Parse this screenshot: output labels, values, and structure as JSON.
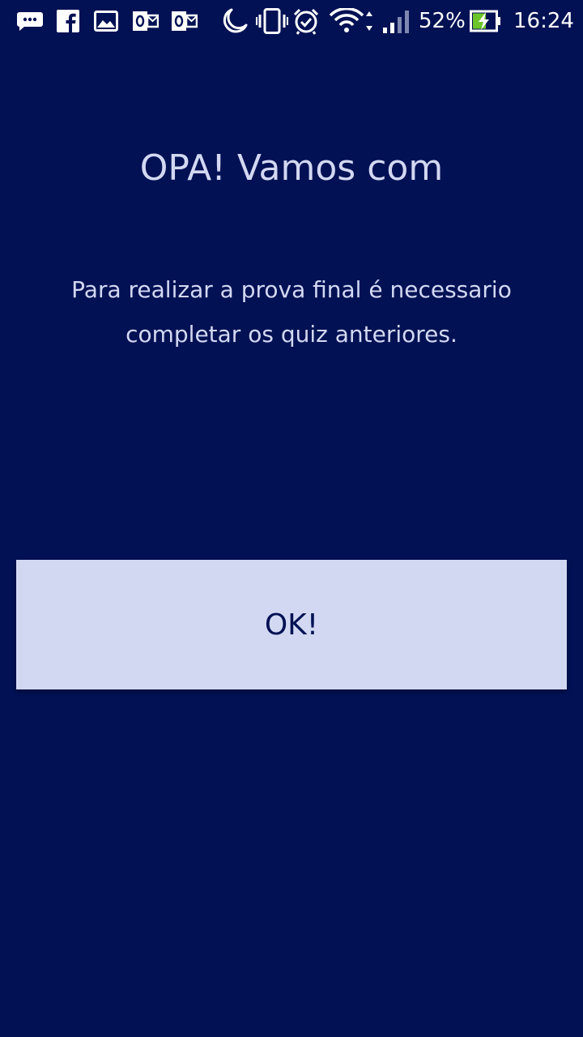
{
  "status_bar": {
    "battery_percent": "52%",
    "time": "16:24",
    "icons": [
      "message-icon",
      "facebook-icon",
      "gallery-icon",
      "outlook-icon",
      "outlook-icon",
      "night-mode-icon",
      "vibrate-icon",
      "alarm-icon",
      "wifi-icon",
      "signal-icon",
      "battery-charging-icon"
    ]
  },
  "dialog": {
    "title": "OPA! Vamos com",
    "message": "Para realizar a prova final é necessario completar os quiz anteriores.",
    "ok_label": "OK!"
  },
  "colors": {
    "background": "#011154",
    "text": "#d3d8f2",
    "button_bg": "#d3d8f2",
    "button_text": "#011154",
    "battery_charge": "#6cc629"
  }
}
